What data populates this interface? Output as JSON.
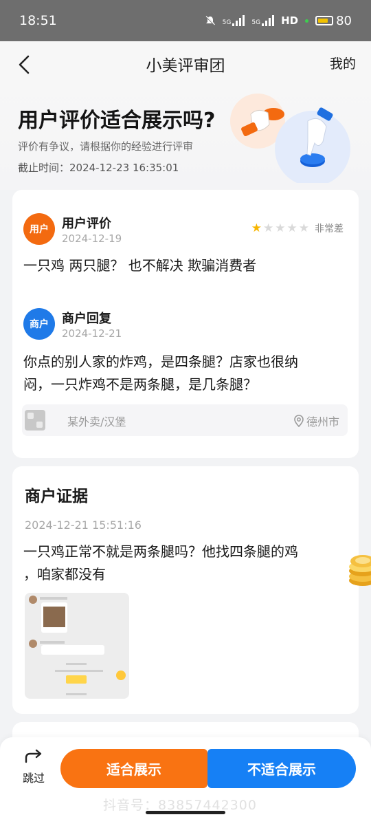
{
  "status_bar": {
    "time": "18:51",
    "signal1": "5G",
    "signal2": "5G",
    "hd": "HD",
    "battery": "80"
  },
  "nav": {
    "title": "小美评审团",
    "right_label": "我的"
  },
  "hero": {
    "title": "用户评价适合展示吗?",
    "subtitle": "评价有争议，请根据你的经验进行评审",
    "deadline": "截止时间：2024-12-23 16:35:01"
  },
  "review": {
    "user": {
      "avatar_label": "用户",
      "label": "用户评价",
      "date": "2024-12-19",
      "rating": 1,
      "max_rating": 5,
      "rating_label": "非常差",
      "text": "一只鸡 两只腿？ 也不解决 欺骗消费者"
    },
    "merchant": {
      "avatar_label": "商户",
      "label": "商户回复",
      "date": "2024-12-21",
      "text_line1": "你点的别人家的炸鸡，是四条腿？店家也很纳",
      "text_line2": "闷，一只炸鸡不是两条腿，是几条腿？"
    },
    "store": {
      "name": "某外卖/汉堡",
      "city": "德州市"
    }
  },
  "evidence": {
    "title": "商户证据",
    "time": "2024-12-21 15:51:16",
    "text_line1": "一只鸡正常不就是两条腿吗？他找四条腿的鸡",
    "text_line2": "，咱家都没有",
    "screenshot_caption": "一只鸡不是四只腿吗@商家",
    "screenshot_reply": "怎么了"
  },
  "actions": {
    "skip_label": "跳过",
    "suitable_label": "适合展示",
    "unsuitable_label": "不适合展示"
  },
  "watermark": "抖音号：83857442300",
  "colors": {
    "orange": "#f97312",
    "blue": "#1680f5",
    "star": "#f7b500"
  }
}
